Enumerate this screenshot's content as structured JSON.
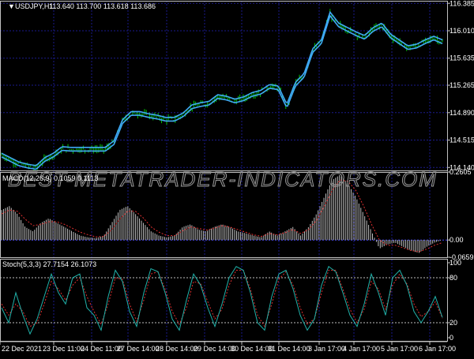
{
  "header": {
    "symbol": "USDJPY,H1",
    "ohlc": "113.640 113.700 113.618 113.686"
  },
  "watermark": "BEST-METATRADER-INDICATORS.COM",
  "colors": {
    "grid": "#1a1a8c",
    "candle": "#00c800",
    "band": "#3fa9f5",
    "macd_hist": "#c0c0c0",
    "macd_signal": "#e03030",
    "stoch_main": "#20b2aa",
    "stoch_signal": "#e03030",
    "axis": "#c0c0c0"
  },
  "chart_data": [
    {
      "type": "line",
      "title": "USDJPY,H1",
      "ylim": [
        114.1,
        116.42
      ],
      "yticks": [
        "116.385",
        "116.010",
        "115.635",
        "115.265",
        "114.890",
        "114.515",
        "114.140"
      ],
      "ytick_values": [
        116.385,
        116.01,
        115.635,
        115.265,
        114.89,
        114.515,
        114.14
      ],
      "close": [
        114.31,
        114.25,
        114.19,
        114.16,
        114.14,
        114.25,
        114.31,
        114.4,
        114.39,
        114.39,
        114.39,
        114.39,
        114.39,
        114.48,
        114.77,
        114.88,
        114.88,
        114.85,
        114.83,
        114.8,
        114.8,
        114.86,
        114.97,
        115.0,
        115.02,
        115.11,
        115.09,
        115.05,
        115.08,
        115.14,
        115.17,
        115.25,
        115.23,
        114.98,
        115.28,
        115.4,
        115.74,
        115.86,
        116.24,
        116.09,
        116.03,
        115.97,
        115.92,
        116.03,
        116.09,
        115.94,
        115.86,
        115.78,
        115.8,
        115.86,
        115.91,
        115.86
      ]
    },
    {
      "type": "bar",
      "title": "MACD(12,26,9) 0.1059 0.1113",
      "ylim": [
        -0.0659,
        0.2605
      ],
      "yticks": [
        "0.2605",
        "0.00",
        "-0.0659"
      ],
      "ytick_values": [
        0.2605,
        0,
        -0.0659
      ],
      "histogram": [
        0.115,
        0.13,
        0.1,
        0.05,
        0.033,
        0.066,
        0.083,
        0.066,
        0.05,
        0.033,
        0.017,
        0.01,
        0.007,
        0.017,
        0.066,
        0.115,
        0.13,
        0.1,
        0.066,
        0.033,
        0.017,
        0.01,
        0.017,
        0.05,
        0.06,
        0.04,
        0.033,
        0.05,
        0.06,
        0.05,
        0.033,
        0.026,
        0.017,
        0.01,
        0.033,
        0.017,
        0.033,
        0.05,
        0.017,
        0.05,
        0.1,
        0.165,
        0.23,
        0.25,
        0.215,
        0.165,
        0.1,
        0.033,
        -0.033,
        -0.017,
        -0.01,
        -0.026,
        -0.04,
        -0.05,
        -0.026,
        -0.01,
        0.0
      ],
      "signal": [
        0.1,
        0.115,
        0.11,
        0.08,
        0.055,
        0.06,
        0.07,
        0.07,
        0.06,
        0.045,
        0.03,
        0.02,
        0.012,
        0.014,
        0.04,
        0.08,
        0.11,
        0.11,
        0.085,
        0.05,
        0.03,
        0.017,
        0.017,
        0.035,
        0.05,
        0.045,
        0.038,
        0.045,
        0.055,
        0.05,
        0.04,
        0.03,
        0.02,
        0.014,
        0.025,
        0.02,
        0.028,
        0.04,
        0.025,
        0.04,
        0.075,
        0.13,
        0.19,
        0.23,
        0.225,
        0.19,
        0.13,
        0.06,
        0.0,
        -0.02,
        -0.02,
        -0.03,
        -0.04,
        -0.045,
        -0.035,
        -0.02,
        -0.01
      ]
    },
    {
      "type": "line",
      "title": "Stoch(5,3,3) 27.7154 26.1073",
      "ylim": [
        0,
        100
      ],
      "yticks": [
        "100",
        "80",
        "20",
        "0"
      ],
      "ytick_values": [
        100,
        80,
        20,
        0
      ],
      "levels": [
        80,
        20
      ],
      "main": [
        40,
        20,
        60,
        30,
        5,
        25,
        55,
        85,
        60,
        45,
        80,
        85,
        40,
        30,
        10,
        55,
        90,
        75,
        35,
        15,
        60,
        92,
        88,
        60,
        25,
        10,
        50,
        85,
        70,
        40,
        15,
        45,
        80,
        95,
        90,
        60,
        20,
        10,
        55,
        85,
        90,
        65,
        30,
        10,
        25,
        70,
        95,
        88,
        60,
        30,
        15,
        45,
        85,
        60,
        30,
        80,
        90,
        70,
        35,
        20,
        35,
        55,
        27
      ],
      "signal": [
        45,
        30,
        45,
        35,
        15,
        20,
        45,
        75,
        65,
        50,
        70,
        80,
        55,
        35,
        18,
        45,
        80,
        78,
        45,
        22,
        50,
        85,
        88,
        65,
        35,
        18,
        40,
        75,
        72,
        48,
        25,
        38,
        70,
        90,
        90,
        65,
        30,
        15,
        45,
        78,
        88,
        70,
        40,
        18,
        25,
        60,
        90,
        90,
        65,
        38,
        20,
        38,
        75,
        65,
        38,
        70,
        85,
        72,
        45,
        28,
        35,
        48,
        26
      ]
    }
  ],
  "time_axis": [
    "22 Dec 2021",
    "23 Dec 11:00",
    "24 Dec 11:00",
    "27 Dec 14:00",
    "28 Dec 14:00",
    "29 Dec 14:00",
    "30 Dec 14:00",
    "31 Dec 14:00",
    "3 Jan 17:00",
    "4 Jan 17:00",
    "5 Jan 17:00",
    "6 Jan 17:00"
  ]
}
